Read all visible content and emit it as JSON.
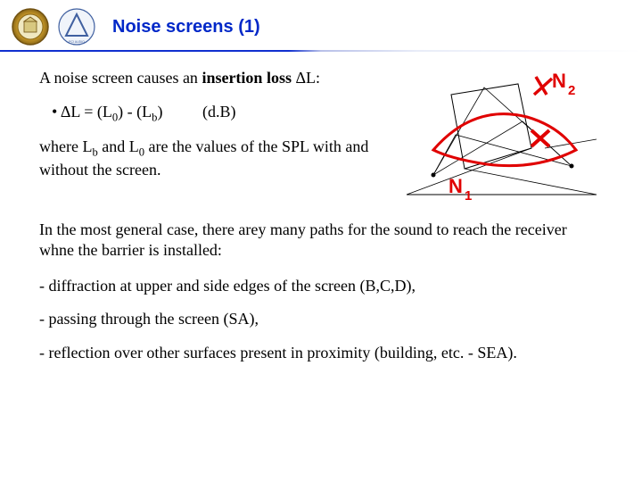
{
  "header": {
    "title": "Noise screens (1)",
    "logo1_alt": "University seal",
    "logo2_alt": "Audio academy logo"
  },
  "intro": {
    "pre": "A noise screen causes an ",
    "bold": "insertion loss",
    "post": " ΔL:"
  },
  "formula": {
    "bullet": "•",
    "delta": "ΔL = (L",
    "sub0": "0",
    "mid": ") - (L",
    "subb": "b",
    "end": ")",
    "unit": "(d.B)"
  },
  "where": {
    "pre": "where L",
    "subb": "b",
    "mid": " and L",
    "sub0": "0",
    "post": " are the values of the SPL with and without the screen."
  },
  "figure": {
    "label_top": "N₂",
    "label_bottom": "N₁"
  },
  "general": "In the most general case, there arey many paths for the sound to reach the receiver whne the barrier is installed:",
  "paths": {
    "diffraction": "- diffraction at upper and side edges of the screen (B,C,D),",
    "through": "- passing through the screen (SA),",
    "reflection": "- reflection over other surfaces present in proximity (building, etc. - SEA)."
  }
}
